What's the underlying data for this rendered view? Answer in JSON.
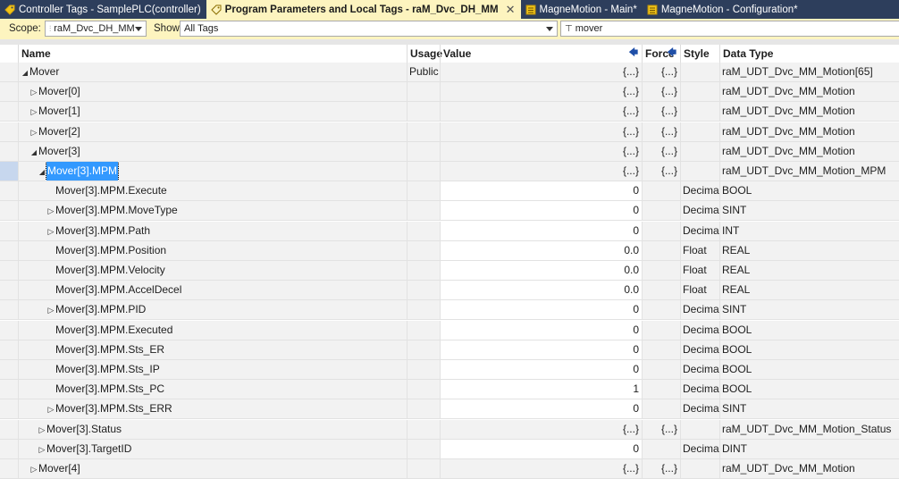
{
  "tabs": [
    {
      "label": "Controller Tags - SamplePLC(controller)",
      "icon": "tag-icon",
      "active": false
    },
    {
      "label": "Program Parameters and Local Tags - raM_Dvc_DH_MM",
      "icon": "tag-outline-icon",
      "active": true
    },
    {
      "label": "MagneMotion - Main*",
      "icon": "routine-icon",
      "active": false
    },
    {
      "label": "MagneMotion - Configuration*",
      "icon": "routine-icon",
      "active": false
    }
  ],
  "toolbar": {
    "scope_label": "Scope:",
    "scope_value": "raM_Dvc_DH_MM",
    "show_label": "Show:",
    "show_value": "All Tags",
    "filter_value": "mover"
  },
  "columns": {
    "name": "Name",
    "usage": "Usage",
    "value": "Value",
    "force": "Force",
    "style": "Style",
    "data_type": "Data Type"
  },
  "rows": [
    {
      "level": 0,
      "toggle": "expanded",
      "name": "Mover",
      "usage": "Public",
      "value": "{...}",
      "force": "{...}",
      "style": "",
      "type": "raM_UDT_Dvc_MM_Motion[65]"
    },
    {
      "level": 1,
      "toggle": "collapsed",
      "name": "Mover[0]",
      "usage": "",
      "value": "{...}",
      "force": "{...}",
      "style": "",
      "type": "raM_UDT_Dvc_MM_Motion"
    },
    {
      "level": 1,
      "toggle": "collapsed",
      "name": "Mover[1]",
      "usage": "",
      "value": "{...}",
      "force": "{...}",
      "style": "",
      "type": "raM_UDT_Dvc_MM_Motion"
    },
    {
      "level": 1,
      "toggle": "collapsed",
      "name": "Mover[2]",
      "usage": "",
      "value": "{...}",
      "force": "{...}",
      "style": "",
      "type": "raM_UDT_Dvc_MM_Motion"
    },
    {
      "level": 1,
      "toggle": "expanded",
      "name": "Mover[3]",
      "usage": "",
      "value": "{...}",
      "force": "{...}",
      "style": "",
      "type": "raM_UDT_Dvc_MM_Motion"
    },
    {
      "level": 2,
      "toggle": "expanded",
      "name": "Mover[3].MPM",
      "usage": "",
      "value": "{...}",
      "force": "{...}",
      "style": "",
      "type": "raM_UDT_Dvc_MM_Motion_MPM",
      "selected": true
    },
    {
      "level": 3,
      "toggle": "none",
      "name": "Mover[3].MPM.Execute",
      "usage": "",
      "value": "0",
      "force": "",
      "style": "Decimal",
      "type": "BOOL"
    },
    {
      "level": 3,
      "toggle": "collapsed",
      "name": "Mover[3].MPM.MoveType",
      "usage": "",
      "value": "0",
      "force": "",
      "style": "Decimal",
      "type": "SINT"
    },
    {
      "level": 3,
      "toggle": "collapsed",
      "name": "Mover[3].MPM.Path",
      "usage": "",
      "value": "0",
      "force": "",
      "style": "Decimal",
      "type": "INT"
    },
    {
      "level": 3,
      "toggle": "none",
      "name": "Mover[3].MPM.Position",
      "usage": "",
      "value": "0.0",
      "force": "",
      "style": "Float",
      "type": "REAL"
    },
    {
      "level": 3,
      "toggle": "none",
      "name": "Mover[3].MPM.Velocity",
      "usage": "",
      "value": "0.0",
      "force": "",
      "style": "Float",
      "type": "REAL"
    },
    {
      "level": 3,
      "toggle": "none",
      "name": "Mover[3].MPM.AccelDecel",
      "usage": "",
      "value": "0.0",
      "force": "",
      "style": "Float",
      "type": "REAL"
    },
    {
      "level": 3,
      "toggle": "collapsed",
      "name": "Mover[3].MPM.PID",
      "usage": "",
      "value": "0",
      "force": "",
      "style": "Decimal",
      "type": "SINT"
    },
    {
      "level": 3,
      "toggle": "none",
      "name": "Mover[3].MPM.Executed",
      "usage": "",
      "value": "0",
      "force": "",
      "style": "Decimal",
      "type": "BOOL"
    },
    {
      "level": 3,
      "toggle": "none",
      "name": "Mover[3].MPM.Sts_ER",
      "usage": "",
      "value": "0",
      "force": "",
      "style": "Decimal",
      "type": "BOOL"
    },
    {
      "level": 3,
      "toggle": "none",
      "name": "Mover[3].MPM.Sts_IP",
      "usage": "",
      "value": "0",
      "force": "",
      "style": "Decimal",
      "type": "BOOL"
    },
    {
      "level": 3,
      "toggle": "none",
      "name": "Mover[3].MPM.Sts_PC",
      "usage": "",
      "value": "1",
      "force": "",
      "style": "Decimal",
      "type": "BOOL"
    },
    {
      "level": 3,
      "toggle": "collapsed",
      "name": "Mover[3].MPM.Sts_ERR",
      "usage": "",
      "value": "0",
      "force": "",
      "style": "Decimal",
      "type": "SINT"
    },
    {
      "level": 2,
      "toggle": "collapsed",
      "name": "Mover[3].Status",
      "usage": "",
      "value": "{...}",
      "force": "{...}",
      "style": "",
      "type": "raM_UDT_Dvc_MM_Motion_Status"
    },
    {
      "level": 2,
      "toggle": "collapsed",
      "name": "Mover[3].TargetID",
      "usage": "",
      "value": "0",
      "force": "",
      "style": "Decimal",
      "type": "DINT"
    },
    {
      "level": 1,
      "toggle": "collapsed",
      "name": "Mover[4]",
      "usage": "",
      "value": "{...}",
      "force": "{...}",
      "style": "",
      "type": "raM_UDT_Dvc_MM_Motion"
    }
  ]
}
